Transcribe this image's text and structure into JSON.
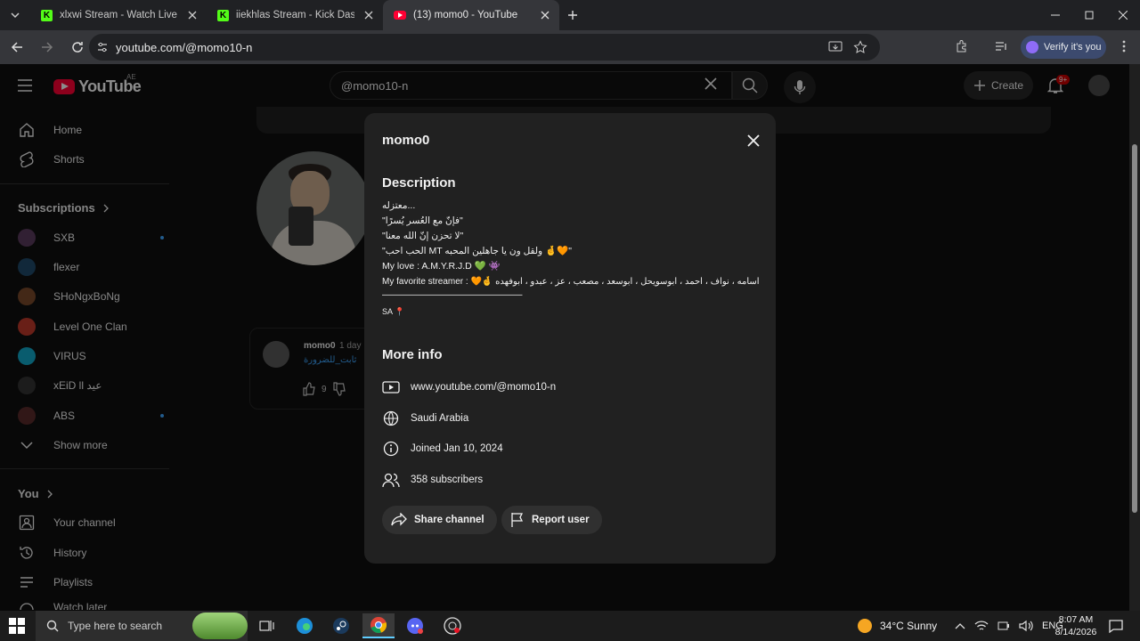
{
  "browser": {
    "tabs": [
      {
        "title": "xlxwi Stream - Watch Live on Ki",
        "favicon": "kick-icon"
      },
      {
        "title": "iiekhlas Stream - Kick Dashboa",
        "favicon": "kick-icon"
      },
      {
        "title": "(13) momo0 - YouTube",
        "favicon": "youtube-icon",
        "active": true
      }
    ],
    "url": "youtube.com/@momo10-n",
    "verify_label": "Verify it's you"
  },
  "youtube": {
    "logo_text": "YouTube",
    "country_code": "AE",
    "search_value": "@momo10-n",
    "create_label": "Create",
    "notification_count": "9+"
  },
  "sidebar": {
    "main": [
      {
        "label": "Home",
        "icon": "home-icon"
      },
      {
        "label": "Shorts",
        "icon": "shorts-icon"
      }
    ],
    "subscriptions_header": "Subscriptions",
    "subscriptions": [
      {
        "label": "SXB",
        "color": "#5a3b5e",
        "live": true
      },
      {
        "label": "flexer",
        "color": "#1f4a6b",
        "live": false
      },
      {
        "label": "SHoNgxBoNg",
        "color": "#7a4a2a",
        "live": false
      },
      {
        "label": "Level One Clan",
        "color": "#c0392b",
        "live": false
      },
      {
        "label": "VIRUS",
        "color": "#11a8c8",
        "live": false
      },
      {
        "label": "xEiD ll عيد",
        "color": "#333333",
        "live": false
      },
      {
        "label": "ABS",
        "color": "#5a2a2a",
        "live": true
      }
    ],
    "show_more": "Show more",
    "you_header": "You",
    "you_items": [
      {
        "label": "Your channel",
        "icon": "your-channel-icon"
      },
      {
        "label": "History",
        "icon": "history-icon"
      },
      {
        "label": "Playlists",
        "icon": "playlists-icon"
      },
      {
        "label": "Watch later",
        "icon": "watch-later-icon"
      }
    ]
  },
  "background": {
    "comment_author": "momo0",
    "comment_time": "1 day",
    "comment_text": "ثابت_للضرورة",
    "comment_likes": "9"
  },
  "modal": {
    "title": "momo0",
    "description_header": "Description",
    "description_lines": [
      "معتزله...",
      "\"فإنّ مع العُسر يُسرًا\"",
      "\"لا تحزن إنّ الله معنا\"",
      "\"الحب احب MT ولقل ون يا جاهلين المحبه 🤞🧡\"",
      "My love : A.M.Y.R.J.D 💚 👾",
      "My favorite streamer : 🧡🤞 اسامه ، نواف ، احمد ، ابوسويحل ، ابوسعد ، مصعب ، عز ، عبدو ، ابوفهده",
      "———————————————",
      "SA 📍"
    ],
    "more_info_header": "More info",
    "info": [
      {
        "icon": "globe-link-icon",
        "text": "www.youtube.com/@momo10-n"
      },
      {
        "icon": "globe-icon",
        "text": "Saudi Arabia"
      },
      {
        "icon": "info-icon",
        "text": "Joined Jan 10, 2024"
      },
      {
        "icon": "subscribers-icon",
        "text": "358 subscribers"
      }
    ],
    "share_label": "Share channel",
    "report_label": "Report user"
  },
  "taskbar": {
    "search_placeholder": "Type here to search",
    "weather": "34°C  Sunny",
    "language": "ENG",
    "time": "8:07 AM",
    "date": "8/14/2026"
  }
}
